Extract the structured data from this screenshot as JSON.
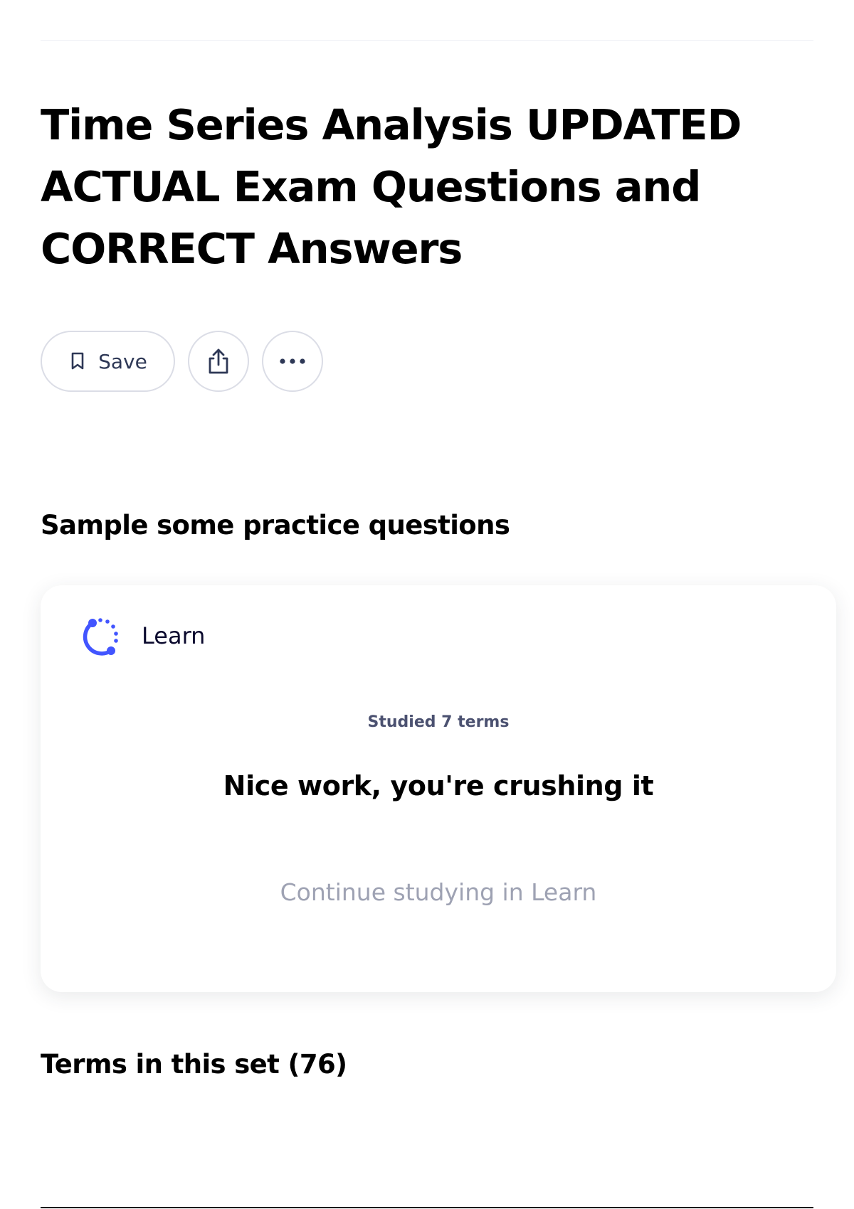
{
  "page": {
    "title": "Time Series Analysis UPDATED ACTUAL Exam Questions and CORRECT Answers"
  },
  "actions": {
    "save_label": "Save",
    "save_icon": "bookmark-icon",
    "share_icon": "share-icon",
    "more_icon": "more-options-icon"
  },
  "practice": {
    "heading": "Sample some practice questions",
    "card": {
      "icon": "learn-progress-icon",
      "title": "Learn",
      "studied": "Studied 7 terms",
      "message": "Nice work, you're crushing it",
      "continue_label": "Continue studying in Learn"
    }
  },
  "terms": {
    "heading": "Terms in this set (76)"
  },
  "colors": {
    "accent": "#4255ff",
    "text_primary": "#000000",
    "text_muted": "#9ea2b3",
    "border": "#dbdde6"
  }
}
